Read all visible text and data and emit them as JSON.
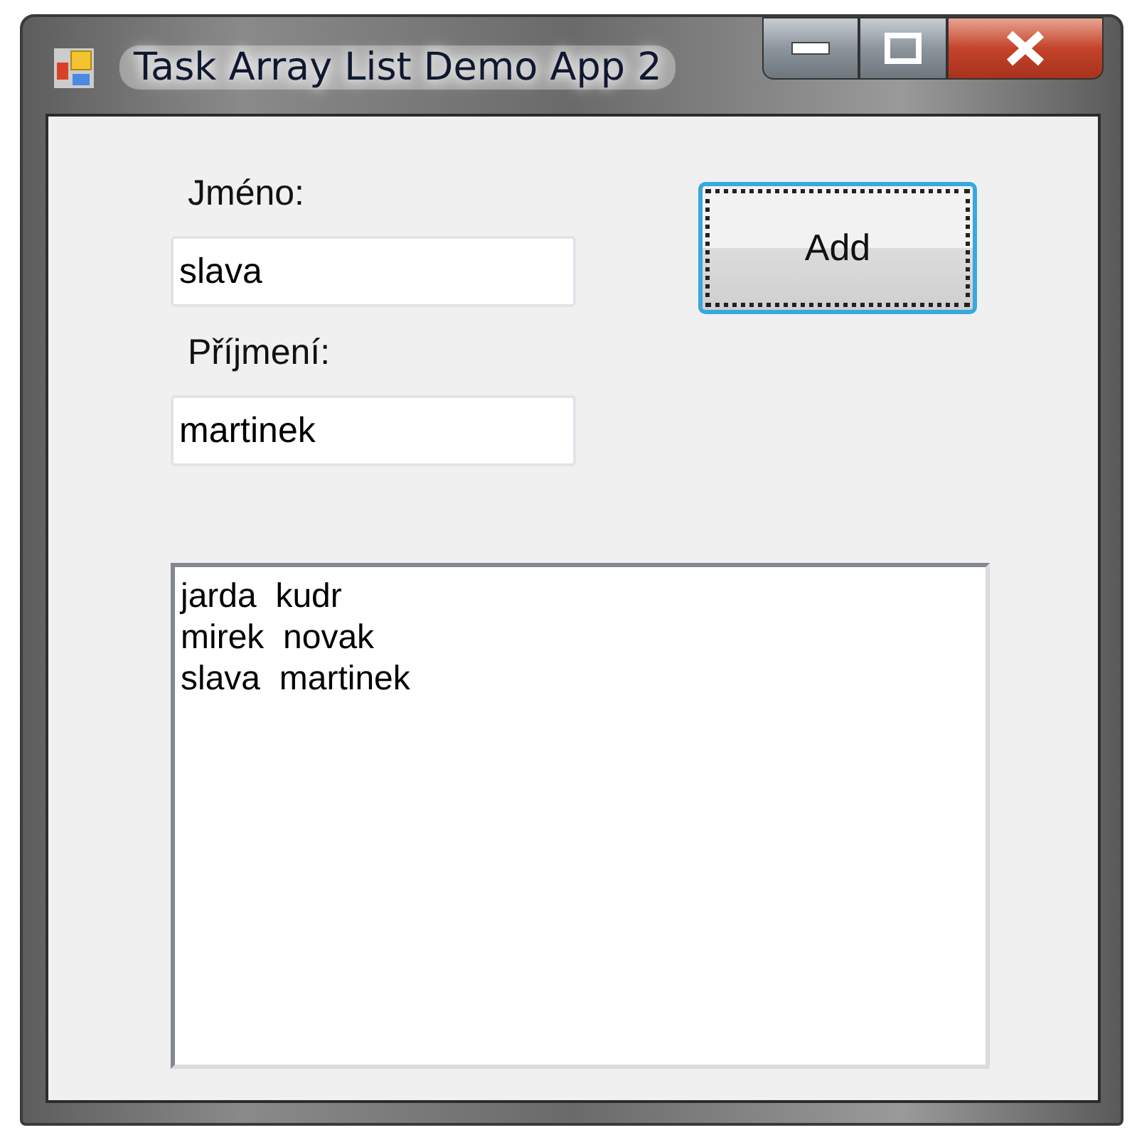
{
  "window": {
    "title": "Task Array List Demo App 2"
  },
  "form": {
    "first_name": {
      "label": "Jméno:",
      "value": "slava"
    },
    "last_name": {
      "label": "Příjmení:",
      "value": "martinek"
    },
    "add_button": {
      "label": "Add",
      "focused": true
    }
  },
  "list": {
    "items": [
      "jarda  kudr",
      "mirek  novak",
      "slava  martinek"
    ]
  }
}
